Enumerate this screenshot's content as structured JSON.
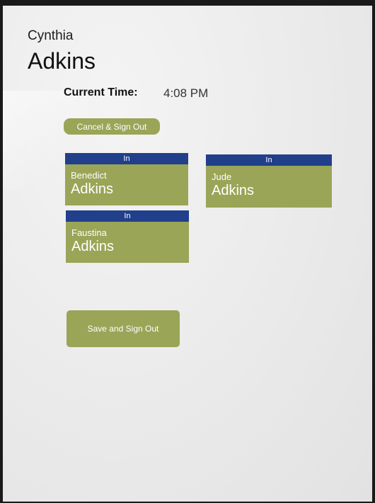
{
  "header": {
    "first_name": "Cynthia",
    "last_name": "Adkins"
  },
  "time": {
    "label": "Current Time:",
    "value": "4:08 PM"
  },
  "actions": {
    "cancel_label": "Cancel & Sign Out",
    "save_label": "Save and Sign Out"
  },
  "cards": [
    {
      "status": "In",
      "first_name": "Benedict",
      "last_name": "Adkins"
    },
    {
      "status": "In",
      "first_name": "Jude",
      "last_name": "Adkins"
    },
    {
      "status": "In",
      "first_name": "Faustina",
      "last_name": "Adkins"
    }
  ],
  "colors": {
    "card_green": "#9aa557",
    "status_blue": "#213f8a",
    "background": "#ececec"
  }
}
